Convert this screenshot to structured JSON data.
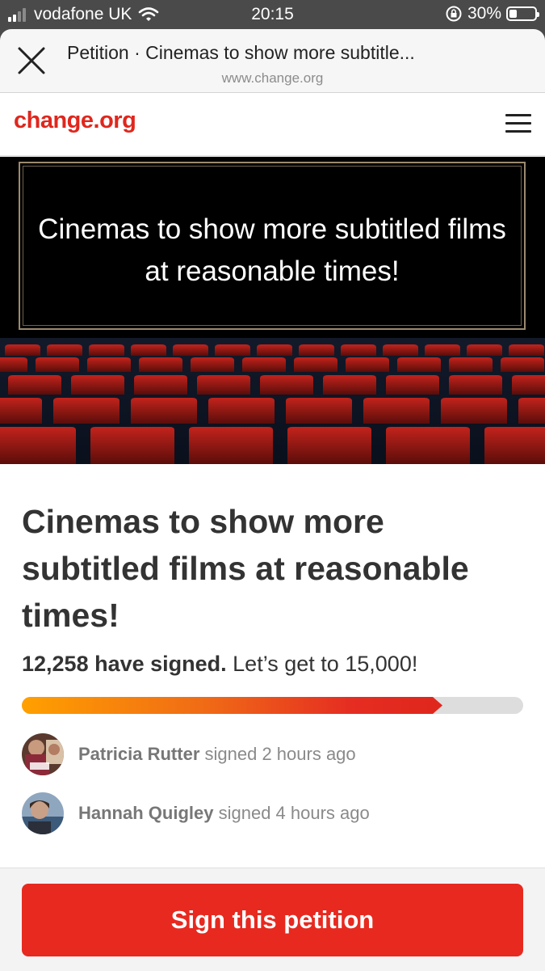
{
  "status_bar": {
    "carrier": "vodafone UK",
    "time": "20:15",
    "battery": "30%",
    "battery_level": 0.3
  },
  "browser": {
    "title": "Petition · Cinemas to show more subtitle...",
    "url": "www.change.org"
  },
  "site": {
    "logo": "change.org"
  },
  "hero": {
    "text": "Cinemas to show more subtitled films at reasonable times!"
  },
  "petition": {
    "title": "Cinemas to show more subtitled films at reasonable times!",
    "signed_count": "12,258 have signed.",
    "goal_text": "Let’s get to 15,000!",
    "progress_fraction": 0.82
  },
  "signers": [
    {
      "name": "Patricia Rutter",
      "action": "signed 2 hours ago"
    },
    {
      "name": "Hannah Quigley",
      "action": "signed 4 hours ago"
    }
  ],
  "cta": {
    "label": "Sign this petition"
  },
  "colors": {
    "brand": "#e0271d",
    "progress_start": "#ffa000",
    "progress_end": "#e0271d"
  }
}
